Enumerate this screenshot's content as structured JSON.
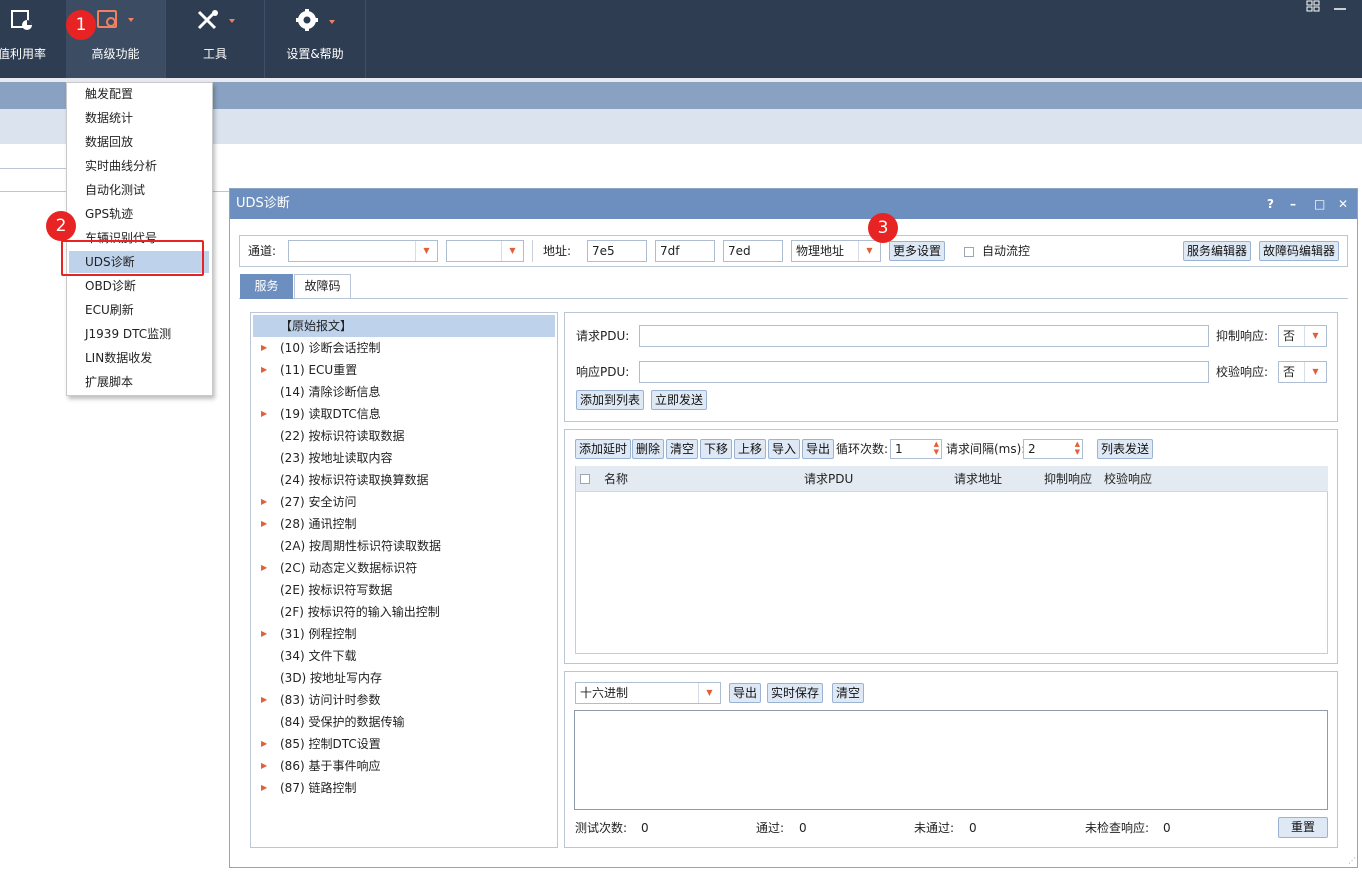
{
  "topbar": {
    "items": [
      {
        "label": "值利用率",
        "icon": "chart-icon"
      },
      {
        "label": "高级功能",
        "icon": "advanced-icon"
      },
      {
        "label": "工具",
        "icon": "tools-icon"
      },
      {
        "label": "设置&帮助",
        "icon": "gear-icon"
      }
    ]
  },
  "badges": [
    "1",
    "2",
    "3"
  ],
  "menu": {
    "items": [
      "触发配置",
      "数据统计",
      "数据回放",
      "实时曲线分析",
      "自动化测试",
      "GPS轨迹",
      "车辆识别代号",
      "UDS诊断",
      "OBD诊断",
      "ECU刷新",
      "J1939 DTC监测",
      "LIN数据收发",
      "扩展脚本"
    ],
    "selected": "UDS诊断"
  },
  "dialog": {
    "title": "UDS诊断",
    "controls": [
      "?",
      "–",
      "□",
      "✕"
    ],
    "toolbar": {
      "channel_label": "通道:",
      "channel_value": "",
      "channel2_value": "",
      "address_label": "地址:",
      "addr1": "7e5",
      "addr2": "7df",
      "addr3": "7ed",
      "addr_type": "物理地址",
      "more_settings": "更多设置",
      "auto_flow": "自动流控",
      "service_editor": "服务编辑器",
      "dtc_editor": "故障码编辑器"
    },
    "tabs": [
      "服务",
      "故障码"
    ],
    "tree": [
      {
        "label": "【原始报文】",
        "expand": false,
        "selected": true
      },
      {
        "label": "(10) 诊断会话控制",
        "expand": true
      },
      {
        "label": "(11) ECU重置",
        "expand": true
      },
      {
        "label": "(14) 清除诊断信息",
        "expand": false
      },
      {
        "label": "(19) 读取DTC信息",
        "expand": true
      },
      {
        "label": "(22) 按标识符读取数据",
        "expand": false
      },
      {
        "label": "(23) 按地址读取内容",
        "expand": false
      },
      {
        "label": "(24) 按标识符读取换算数据",
        "expand": false
      },
      {
        "label": "(27) 安全访问",
        "expand": true
      },
      {
        "label": "(28) 通讯控制",
        "expand": true
      },
      {
        "label": "(2A) 按周期性标识符读取数据",
        "expand": false
      },
      {
        "label": "(2C) 动态定义数据标识符",
        "expand": true
      },
      {
        "label": "(2E) 按标识符写数据",
        "expand": false
      },
      {
        "label": "(2F) 按标识符的输入输出控制",
        "expand": false
      },
      {
        "label": "(31) 例程控制",
        "expand": true
      },
      {
        "label": "(34) 文件下载",
        "expand": false
      },
      {
        "label": "(3D) 按地址写内存",
        "expand": false
      },
      {
        "label": "(83) 访问计时参数",
        "expand": true
      },
      {
        "label": "(84) 受保护的数据传输",
        "expand": false
      },
      {
        "label": "(85) 控制DTC设置",
        "expand": true
      },
      {
        "label": "(86) 基于事件响应",
        "expand": true
      },
      {
        "label": "(87) 链路控制",
        "expand": true
      }
    ],
    "pdu": {
      "request_label": "请求PDU:",
      "request_value": "",
      "response_label": "响应PDU:",
      "response_value": "",
      "suppress_label": "抑制响应:",
      "suppress_value": "否",
      "verify_label": "校验响应:",
      "verify_value": "否",
      "add_to_list": "添加到列表",
      "send_now": "立即发送"
    },
    "list_toolbar": {
      "add_delay": "添加延时",
      "delete": "删除",
      "clear": "清空",
      "down": "下移",
      "up": "上移",
      "import": "导入",
      "export": "导出",
      "loop_label": "循环次数:",
      "loop_value": "1",
      "interval_label": "请求间隔(ms):",
      "interval_value": "2",
      "list_send": "列表发送"
    },
    "grid_headers": [
      "名称",
      "请求PDU",
      "请求地址",
      "抑制响应",
      "校验响应"
    ],
    "log": {
      "format_value": "十六进制",
      "export": "导出",
      "realtime_save": "实时保存",
      "clear": "清空"
    },
    "stats": {
      "test_count_label": "测试次数:",
      "test_count": "0",
      "pass_label": "通过:",
      "pass": "0",
      "fail_label": "未通过:",
      "fail": "0",
      "unchecked_label": "未检查响应:",
      "unchecked": "0",
      "reset": "重置"
    }
  }
}
